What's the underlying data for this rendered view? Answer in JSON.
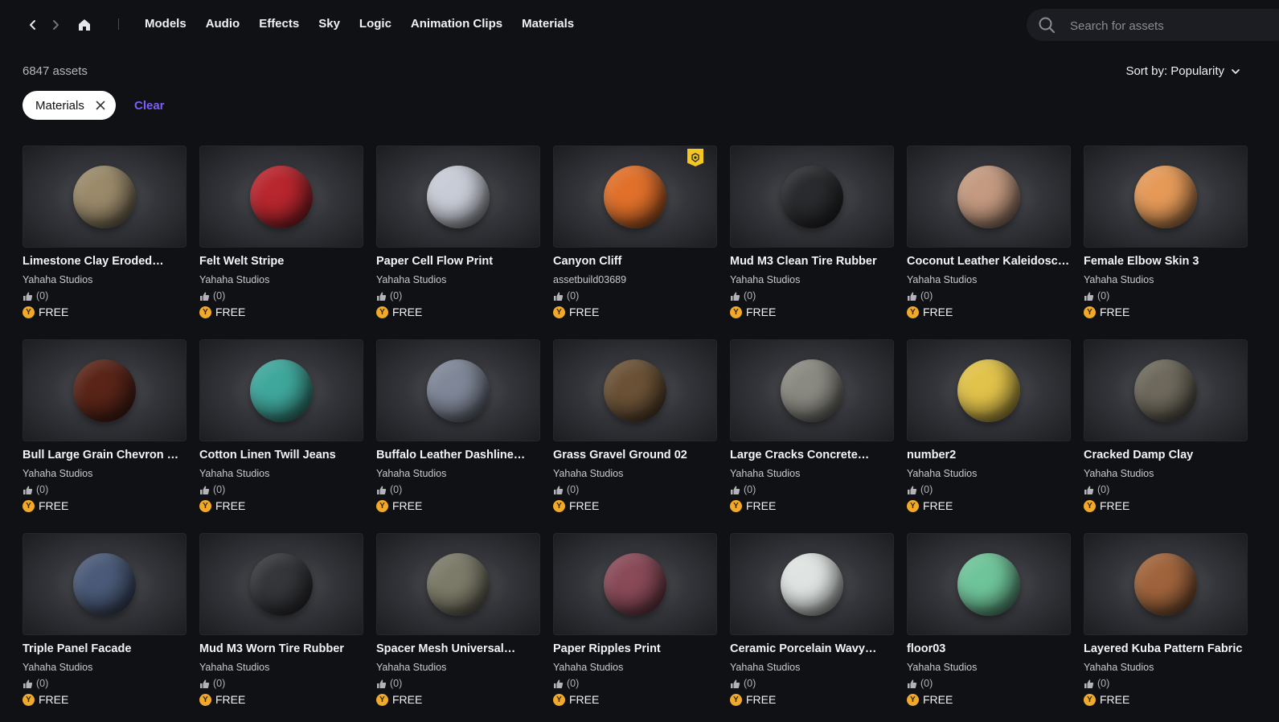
{
  "nav": {
    "categories": [
      "Models",
      "Audio",
      "Effects",
      "Sky",
      "Logic",
      "Animation Clips",
      "Materials"
    ]
  },
  "search": {
    "placeholder": "Search for assets"
  },
  "results": {
    "count_label": "6847 assets",
    "sort_label": "Sort by: Popularity"
  },
  "filters": {
    "chip_label": "Materials",
    "clear_label": "Clear"
  },
  "assets": [
    {
      "name": "Limestone Clay Eroded…",
      "author": "Yahaha Studios",
      "likes": "(0)",
      "price": "FREE",
      "color": "#9a8a6a",
      "badge": false
    },
    {
      "name": "Felt Welt Stripe",
      "author": "Yahaha Studios",
      "likes": "(0)",
      "price": "FREE",
      "color": "#b8262e",
      "badge": false
    },
    {
      "name": "Paper Cell Flow Print",
      "author": "Yahaha Studios",
      "likes": "(0)",
      "price": "FREE",
      "color": "#c8ccd6",
      "badge": false
    },
    {
      "name": "Canyon Cliff",
      "author": "assetbuild03689",
      "likes": "(0)",
      "price": "FREE",
      "color": "#e0702a",
      "badge": true
    },
    {
      "name": "Mud M3 Clean Tire Rubber",
      "author": "Yahaha Studios",
      "likes": "(0)",
      "price": "FREE",
      "color": "#2a2b2e",
      "badge": false
    },
    {
      "name": "Coconut Leather Kaleidoscop…",
      "author": "Yahaha Studios",
      "likes": "(0)",
      "price": "FREE",
      "color": "#c49a80",
      "badge": false
    },
    {
      "name": "Female Elbow Skin 3",
      "author": "Yahaha Studios",
      "likes": "(0)",
      "price": "FREE",
      "color": "#e59a58",
      "badge": false
    },
    {
      "name": "Bull Large Grain Chevron Quilt",
      "author": "Yahaha Studios",
      "likes": "(0)",
      "price": "FREE",
      "color": "#5a2418",
      "badge": false
    },
    {
      "name": "Cotton Linen Twill Jeans",
      "author": "Yahaha Studios",
      "likes": "(0)",
      "price": "FREE",
      "color": "#3fa79c",
      "badge": false
    },
    {
      "name": "Buffalo Leather Dashline…",
      "author": "Yahaha Studios",
      "likes": "(0)",
      "price": "FREE",
      "color": "#7f8798",
      "badge": false
    },
    {
      "name": "Grass Gravel Ground 02",
      "author": "Yahaha Studios",
      "likes": "(0)",
      "price": "FREE",
      "color": "#6b5236",
      "badge": false
    },
    {
      "name": "Large Cracks Concrete…",
      "author": "Yahaha Studios",
      "likes": "(0)",
      "price": "FREE",
      "color": "#8b8a82",
      "badge": false
    },
    {
      "name": "number2",
      "author": "Yahaha Studios",
      "likes": "(0)",
      "price": "FREE",
      "color": "#e1c24a",
      "badge": false
    },
    {
      "name": "Cracked Damp Clay",
      "author": "Yahaha Studios",
      "likes": "(0)",
      "price": "FREE",
      "color": "#6e695c",
      "badge": false
    },
    {
      "name": "Triple Panel Facade",
      "author": "Yahaha Studios",
      "likes": "(0)",
      "price": "FREE",
      "color": "#4a5a78",
      "badge": false
    },
    {
      "name": "Mud M3 Worn Tire Rubber",
      "author": "Yahaha Studios",
      "likes": "(0)",
      "price": "FREE",
      "color": "#35363a",
      "badge": false
    },
    {
      "name": "Spacer Mesh Universal…",
      "author": "Yahaha Studios",
      "likes": "(0)",
      "price": "FREE",
      "color": "#7c7a68",
      "badge": false
    },
    {
      "name": "Paper Ripples Print",
      "author": "Yahaha Studios",
      "likes": "(0)",
      "price": "FREE",
      "color": "#8a4a58",
      "badge": false
    },
    {
      "name": "Ceramic Porcelain Wavy…",
      "author": "Yahaha Studios",
      "likes": "(0)",
      "price": "FREE",
      "color": "#dfe4e2",
      "badge": false
    },
    {
      "name": "floor03",
      "author": "Yahaha Studios",
      "likes": "(0)",
      "price": "FREE",
      "color": "#6fc49a",
      "badge": false
    },
    {
      "name": "Layered Kuba Pattern Fabric",
      "author": "Yahaha Studios",
      "likes": "(0)",
      "price": "FREE",
      "color": "#a0643c",
      "badge": false
    }
  ]
}
